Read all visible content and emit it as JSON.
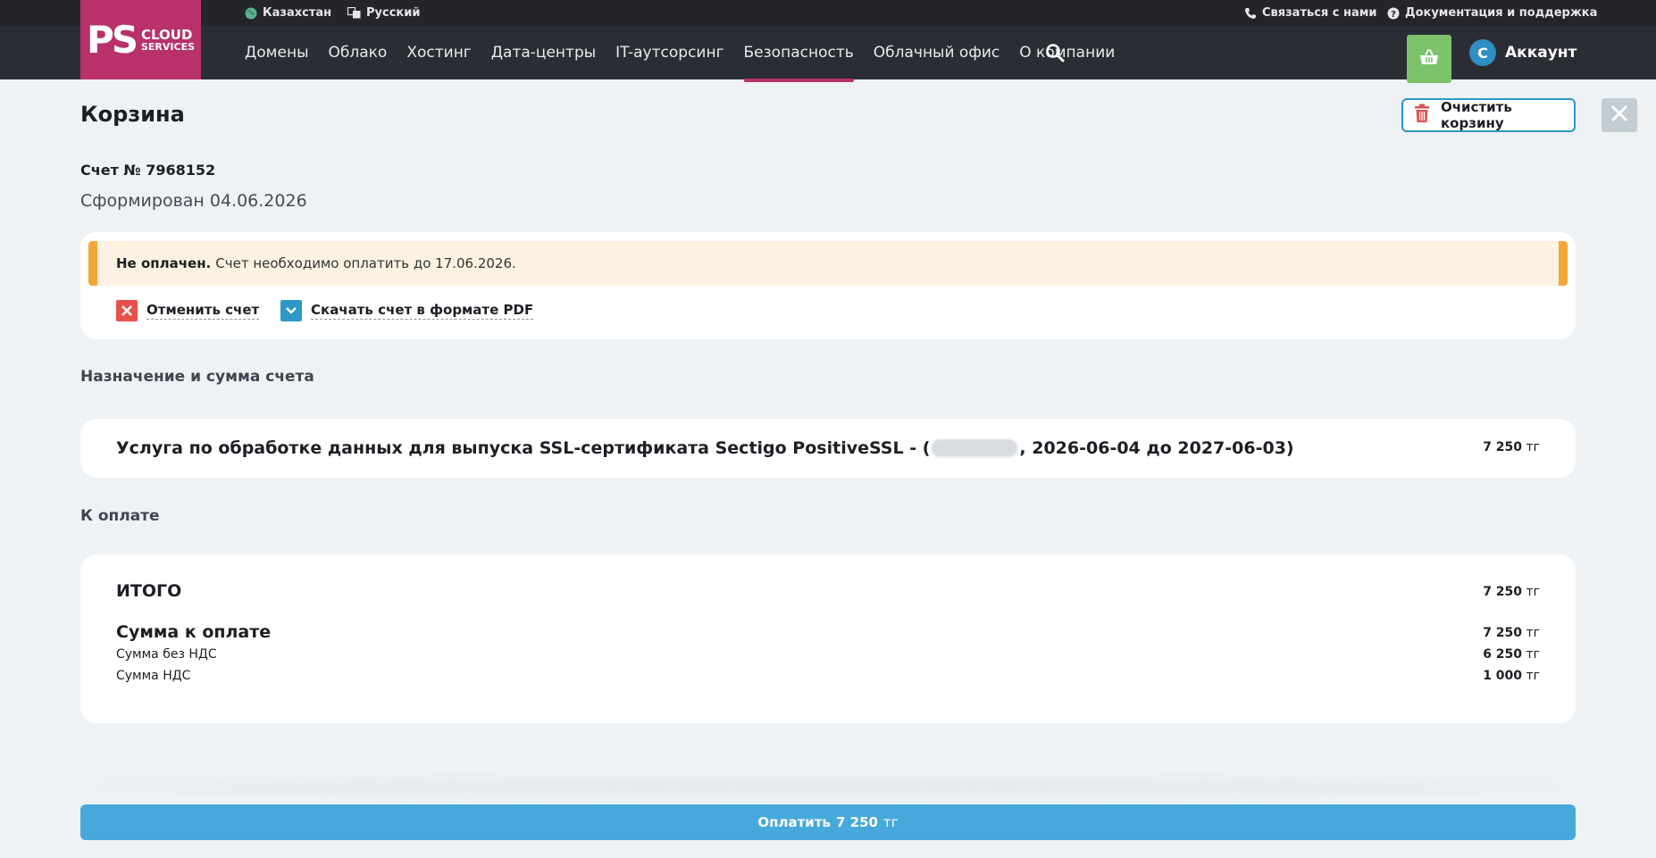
{
  "topbar": {
    "region": "Казахстан",
    "language": "Русский",
    "contact": "Связаться с нами",
    "docs": "Документация и поддержка"
  },
  "logo": {
    "mark": "PS",
    "line1": "CLOUD",
    "line2": "SERVICES"
  },
  "nav": {
    "items": [
      {
        "label": "Домены"
      },
      {
        "label": "Облако"
      },
      {
        "label": "Хостинг"
      },
      {
        "label": "Дата-центры"
      },
      {
        "label": "IT-аутсорсинг"
      },
      {
        "label": "Безопасность",
        "active": true
      },
      {
        "label": "Облачный офис"
      },
      {
        "label": "О компании"
      }
    ],
    "search_icon": "search-icon",
    "cart_icon": "basket-icon"
  },
  "account": {
    "initial": "С",
    "label": "Аккаунт"
  },
  "page": {
    "title": "Корзина",
    "clear_cart": "Очистить корзину",
    "invoice_number": "Счет № 7968152",
    "invoice_date": "Сформирован 04.06.2026"
  },
  "status": {
    "title": "Не оплачен.",
    "text": "Счет необходимо оплатить до 17.06.2026.",
    "cancel": "Отменить счет",
    "download": "Скачать счет в формате PDF"
  },
  "sections": {
    "purpose": "Назначение и сумма счета",
    "to_pay": "К оплате"
  },
  "line_item": {
    "desc_before": "Услуга по обработке данных для выпуска SSL-сертификата Sectigo PositiveSSL - (",
    "desc_after": ", 2026-06-04 до 2027-06-03)",
    "amount": "7 250",
    "currency": "тг"
  },
  "totals": {
    "total_label": "ИТОГО",
    "total_amount": "7 250",
    "due_label": "Сумма к оплате",
    "due_amount": "7 250",
    "no_vat_label": "Сумма без НДС",
    "no_vat_amount": "6 250",
    "vat_label": "Сумма НДС",
    "vat_amount": "1 000",
    "currency": "тг"
  },
  "pay": {
    "label": "Оплатить",
    "amount": "7 250",
    "currency": "тг"
  },
  "colors": {
    "brand": "#b8316b",
    "accent": "#47a9db",
    "warning": "#f2a838",
    "cart": "#7cc26a"
  }
}
